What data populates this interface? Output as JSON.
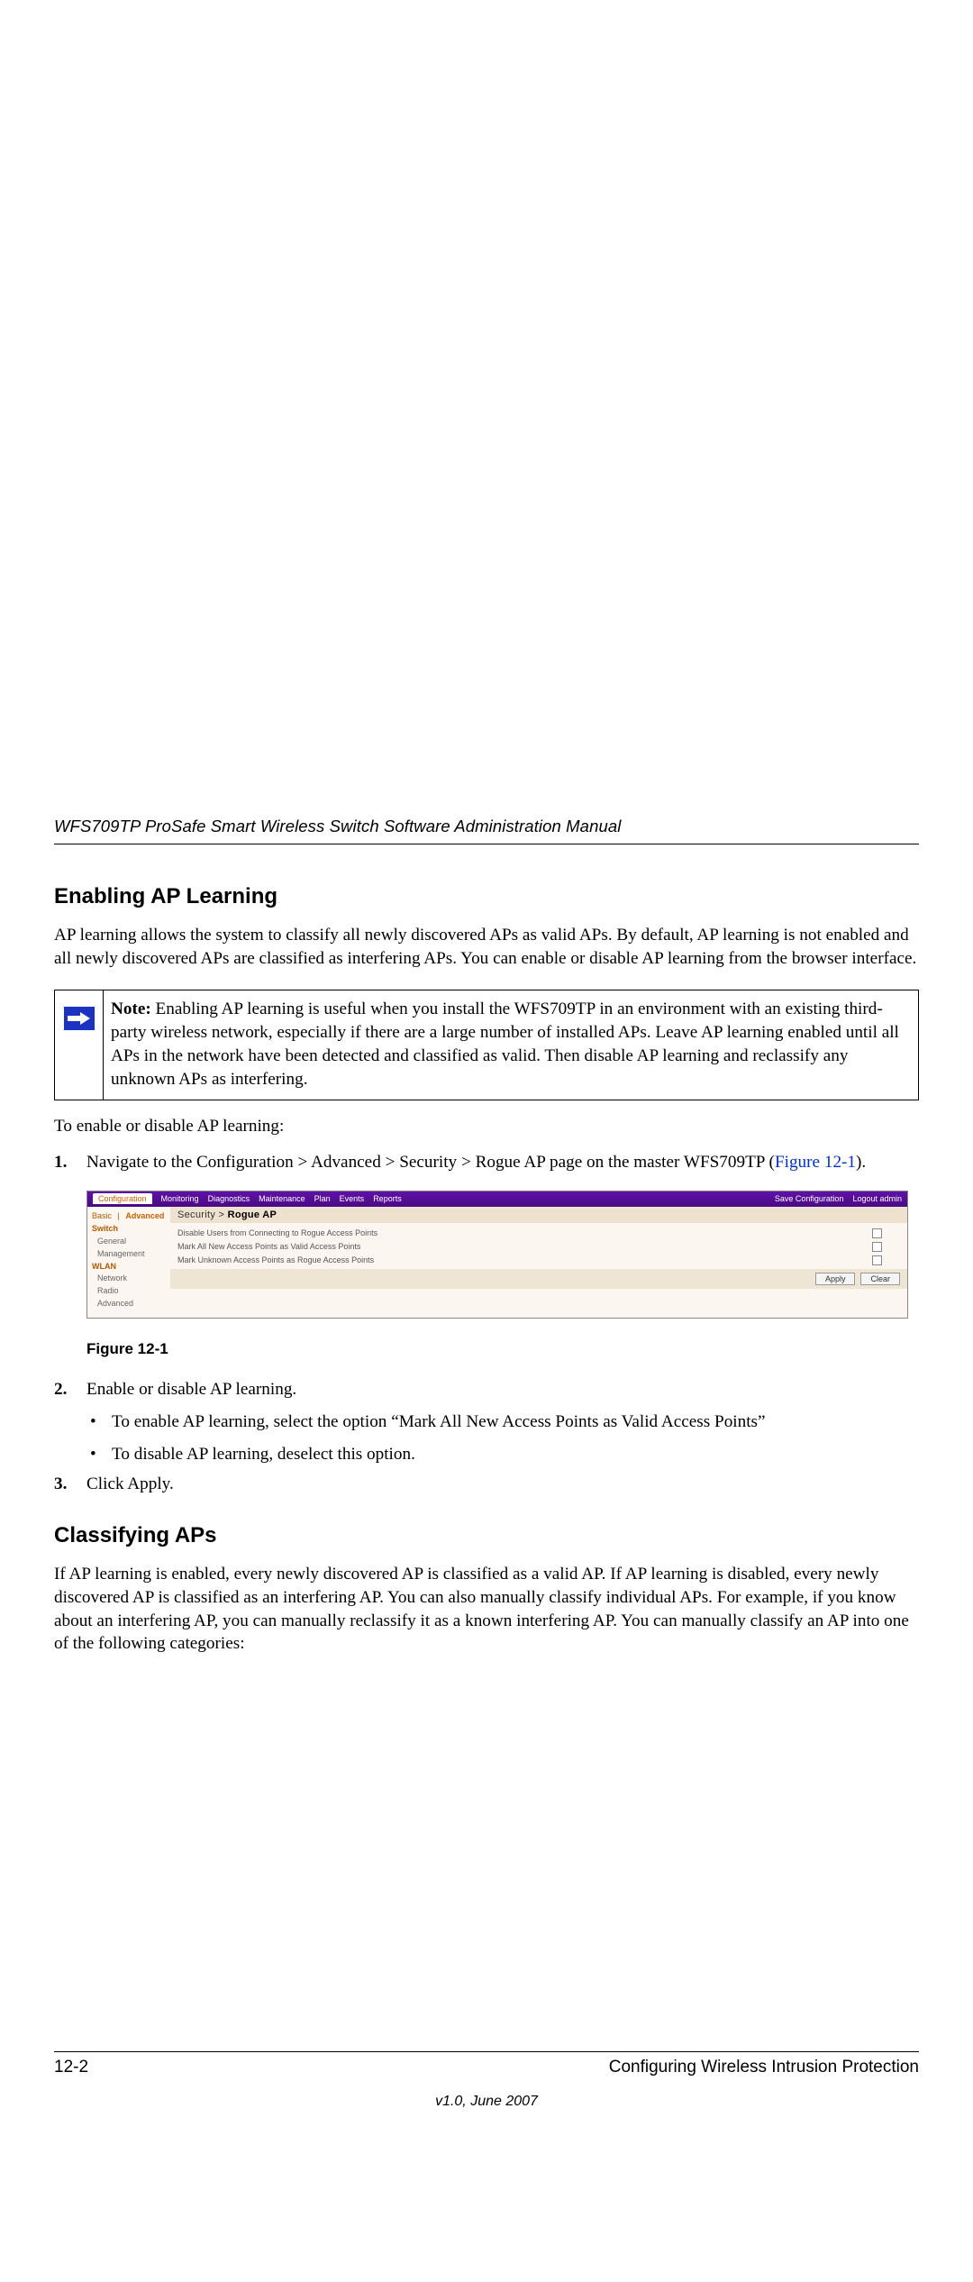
{
  "header": {
    "doc_title": "WFS709TP ProSafe Smart Wireless Switch Software Administration Manual"
  },
  "s1": {
    "title": "Enabling AP Learning",
    "intro": "AP learning allows the system to classify all newly discovered APs as valid APs. By default, AP learning is not enabled and all newly discovered APs are classified as interfering APs. You can enable or disable AP learning from the browser interface.",
    "note_label": "Note:",
    "note_body": " Enabling AP learning is useful when you install the WFS709TP in an environment with an existing third-party wireless network, especially if there are a large number of installed APs. Leave AP learning enabled until all APs in the network have been detected and classified as valid. Then disable AP learning and reclassify any unknown APs as interfering.",
    "lead": "To enable or disable AP learning:",
    "step1_a": "Navigate to the Configuration > Advanced > Security > Rogue AP page on the master WFS709TP (",
    "step1_link": "Figure 12-1",
    "step1_b": ").",
    "fig_caption": "Figure 12-1",
    "step2": "Enable or disable AP learning.",
    "step2_a": "To enable AP learning, select the option “Mark All New Access Points as Valid Access Points”",
    "step2_b": "To disable AP learning, deselect this option.",
    "step3": "Click Apply.",
    "nums": {
      "n1": "1.",
      "n2": "2.",
      "n3": "3."
    }
  },
  "fig": {
    "tabs": {
      "configuration": "Configuration",
      "monitoring": "Monitoring",
      "diagnostics": "Diagnostics",
      "maintenance": "Maintenance",
      "plan": "Plan",
      "events": "Events",
      "reports": "Reports"
    },
    "right": {
      "save": "Save Configuration",
      "logout": "Logout admin"
    },
    "side_mode": {
      "basic": "Basic",
      "sep": "|",
      "advanced": "Advanced"
    },
    "side": {
      "switch": "Switch",
      "general": "General",
      "management": "Management",
      "wlan": "WLAN",
      "network": "Network",
      "radio": "Radio",
      "advanced": "Advanced"
    },
    "crumb_a": "Security > ",
    "crumb_b": "Rogue AP",
    "rows": {
      "r1": "Disable Users from Connecting to Rogue Access Points",
      "r2": "Mark All New Access Points as Valid Access Points",
      "r3": "Mark Unknown Access Points as Rogue Access Points"
    },
    "btn": {
      "apply": "Apply",
      "clear": "Clear"
    }
  },
  "s2": {
    "title": "Classifying APs",
    "body": "If AP learning is enabled, every newly discovered AP is classified as a valid AP. If AP learning is disabled, every newly discovered AP is classified as an interfering AP. You can also manually classify individual APs. For example, if you know about an interfering AP, you can manually reclassify it as a known interfering AP. You can manually classify an AP into one of the following categories:"
  },
  "footer": {
    "page": "12-2",
    "section": "Configuring Wireless Intrusion Protection",
    "version": "v1.0, June 2007"
  }
}
